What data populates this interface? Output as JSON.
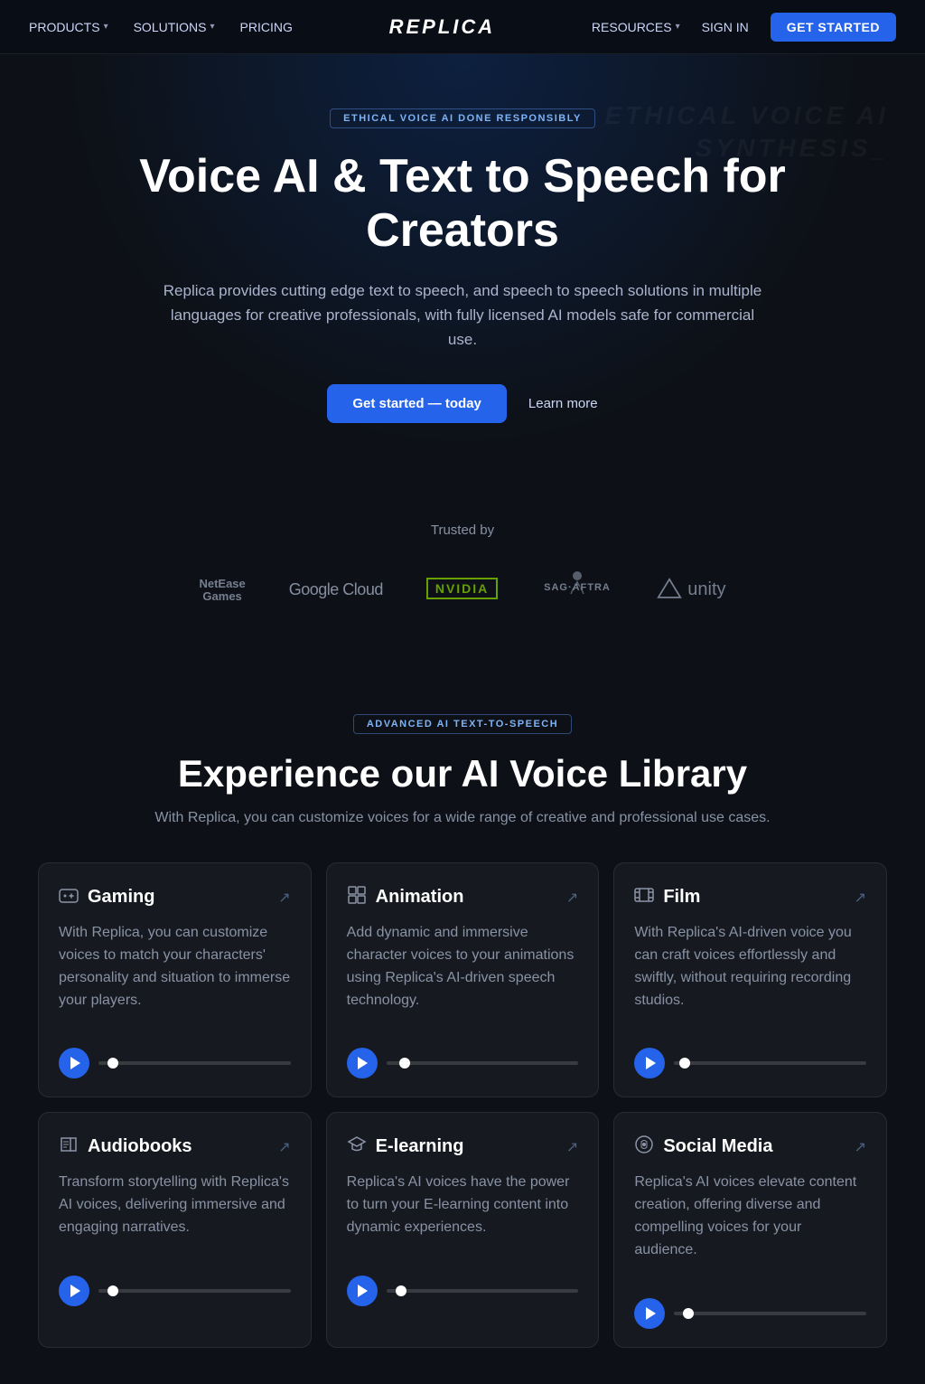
{
  "nav": {
    "logo": "REPLICA",
    "left_items": [
      {
        "label": "PRODUCTS",
        "has_chevron": true
      },
      {
        "label": "SOLUTIONS",
        "has_chevron": true
      },
      {
        "label": "PRICING",
        "has_chevron": false
      }
    ],
    "right_items": [
      {
        "label": "RESOURCES",
        "has_chevron": true
      },
      {
        "label": "SIGN IN",
        "has_chevron": false
      }
    ],
    "cta_label": "GET STARTED"
  },
  "hero": {
    "badge": "ETHICAL VOICE AI DONE RESPONSIBLY",
    "heading": "Voice AI & Text to Speech for Creators",
    "description": "Replica provides cutting edge text to speech, and speech to speech solutions in multiple languages for creative professionals, with fully licensed AI models safe for commercial use.",
    "cta_primary": "Get started — today",
    "cta_secondary": "Learn more",
    "bg_text_line1": "ETHICAL VOICE AI",
    "bg_text_line2": "SYNTHESIS_"
  },
  "trusted": {
    "title": "Trusted by",
    "logos": [
      {
        "name": "NetEase Games",
        "type": "netease"
      },
      {
        "name": "Google Cloud",
        "type": "google"
      },
      {
        "name": "NVIDIA",
        "type": "nvidia"
      },
      {
        "name": "SAG-AFTRA",
        "type": "sag"
      },
      {
        "name": "Unity",
        "type": "unity"
      }
    ]
  },
  "voice_section": {
    "badge": "ADVANCED AI TEXT-TO-SPEECH",
    "heading": "Experience our AI Voice Library",
    "description": "With Replica, you can customize voices for a wide range of creative and professional use cases.",
    "cards": [
      {
        "id": "gaming",
        "icon": "👤",
        "title": "Gaming",
        "description": "With Replica, you can customize voices to match your characters' personality and situation to immerse your players."
      },
      {
        "id": "animation",
        "icon": "🎭",
        "title": "Animation",
        "description": "Add dynamic and immersive character voices to your animations using Replica's AI-driven speech technology."
      },
      {
        "id": "film",
        "icon": "🎬",
        "title": "Film",
        "description": "With Replica's AI-driven voice you can craft voices effortlessly and swiftly, without requiring recording studios."
      },
      {
        "id": "audiobooks",
        "icon": "📖",
        "title": "Audiobooks",
        "description": "Transform storytelling with Replica's AI voices, delivering immersive and engaging narratives."
      },
      {
        "id": "elearning",
        "icon": "🎓",
        "title": "E-learning",
        "description": "Replica's AI voices have the power to turn your E-learning content into dynamic experiences."
      },
      {
        "id": "socialmedia",
        "icon": "🎙️",
        "title": "Social Media",
        "description": "Replica's AI voices elevate content creation, offering diverse and compelling voices for your audience."
      }
    ]
  }
}
